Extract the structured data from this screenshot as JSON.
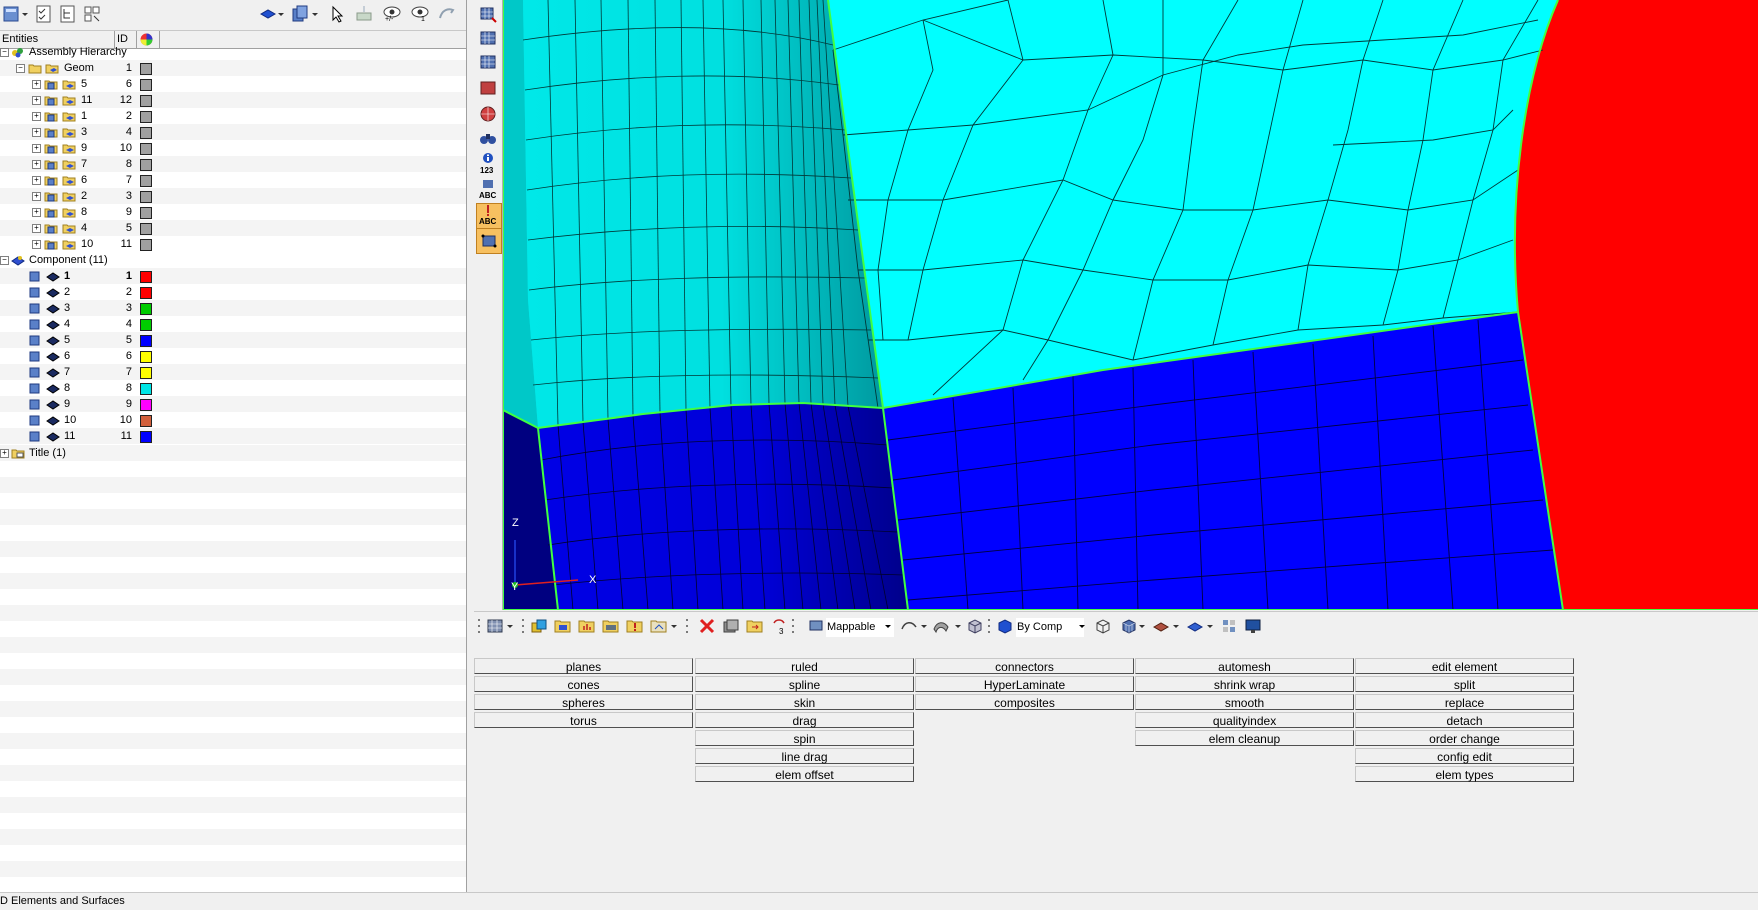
{
  "tree_header": {
    "entities": "Entities",
    "id": "ID"
  },
  "tree": {
    "assembly": "Assembly Hierarchy",
    "geom": {
      "label": "Geom",
      "id": "1"
    },
    "geom_children": [
      {
        "label": "5",
        "id": "6"
      },
      {
        "label": "11",
        "id": "12"
      },
      {
        "label": "1",
        "id": "2"
      },
      {
        "label": "3",
        "id": "4"
      },
      {
        "label": "9",
        "id": "10"
      },
      {
        "label": "7",
        "id": "8"
      },
      {
        "label": "6",
        "id": "7"
      },
      {
        "label": "2",
        "id": "3"
      },
      {
        "label": "8",
        "id": "9"
      },
      {
        "label": "4",
        "id": "5"
      },
      {
        "label": "10",
        "id": "11"
      }
    ],
    "component": "Component (11)",
    "components": [
      {
        "label": "1",
        "id": "1",
        "color": "#ff0000"
      },
      {
        "label": "2",
        "id": "2",
        "color": "#ff0000"
      },
      {
        "label": "3",
        "id": "3",
        "color": "#00cc00"
      },
      {
        "label": "4",
        "id": "4",
        "color": "#00cc00"
      },
      {
        "label": "5",
        "id": "5",
        "color": "#0000ff"
      },
      {
        "label": "6",
        "id": "6",
        "color": "#ffff00"
      },
      {
        "label": "7",
        "id": "7",
        "color": "#ffff00"
      },
      {
        "label": "8",
        "id": "8",
        "color": "#00e5e5"
      },
      {
        "label": "9",
        "id": "9",
        "color": "#ff00ff"
      },
      {
        "label": "10",
        "id": "10",
        "color": "#d2603c"
      },
      {
        "label": "11",
        "id": "11",
        "color": "#0000ff"
      }
    ],
    "title": "Title (1)"
  },
  "side_toolbar": {
    "info_label": "123",
    "abc_label": "ABC",
    "abc2_label": "ABC"
  },
  "top_toolbar": {
    "eye1_label": "+/-",
    "eye2_label": "1"
  },
  "viewport": {
    "axis_z": "Z",
    "axis_x": "X",
    "axis_y": "Y"
  },
  "bottom_toolbar": {
    "mesh_mode": "Mappable",
    "color_mode": "By Comp",
    "counter": "3"
  },
  "menu": {
    "col1": [
      "planes",
      "cones",
      "spheres",
      "torus"
    ],
    "col2": [
      "ruled",
      "spline",
      "skin",
      "drag",
      "spin",
      "line drag",
      "elem offset"
    ],
    "col3": [
      "connectors",
      "HyperLaminate",
      "composites"
    ],
    "col4": [
      "automesh",
      "shrink wrap",
      "smooth",
      "qualityindex",
      "elem cleanup"
    ],
    "col5": [
      "edit element",
      "split",
      "replace",
      "detach",
      "order change",
      "config edit",
      "elem types"
    ]
  },
  "status": "D Elements and Surfaces"
}
